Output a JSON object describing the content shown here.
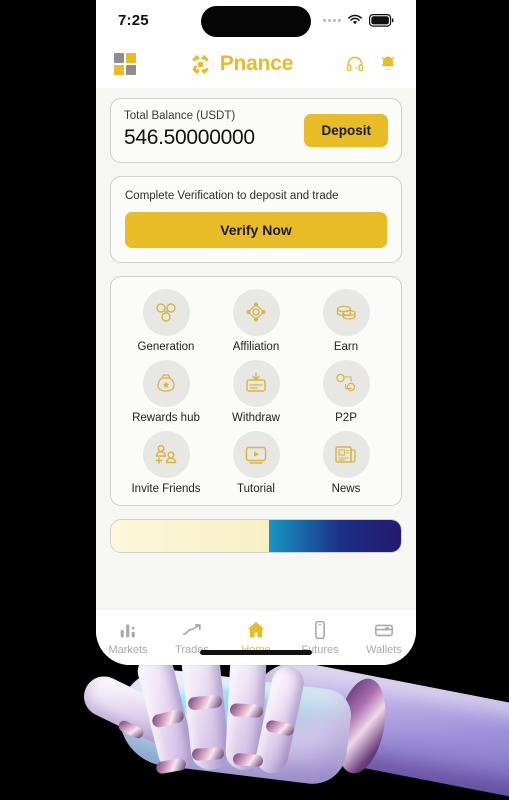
{
  "status_bar": {
    "time": "7:25",
    "signal_icon": "signal-dots-icon",
    "wifi_icon": "wifi-icon",
    "battery_icon": "battery-full-icon"
  },
  "header": {
    "logo_icon": "app-squares-logo-icon",
    "brand_mark_icon": "pnance-diamond-logo-icon",
    "brand_name": "Pnance",
    "support_icon": "headset-support-icon",
    "notification_icon": "bell-notification-icon"
  },
  "balance_card": {
    "label": "Total Balance (USDT)",
    "value": "546.50000000",
    "deposit_label": "Deposit"
  },
  "verification_card": {
    "message": "Complete Verification to deposit and trade",
    "button_label": "Verify Now"
  },
  "shortcuts": [
    {
      "label": "Generation",
      "icon": "generation-network-icon"
    },
    {
      "label": "Affiliation",
      "icon": "affiliation-nodes-icon"
    },
    {
      "label": "Earn",
      "icon": "earn-coins-icon"
    },
    {
      "label": "Rewards hub",
      "icon": "rewards-money-bag-icon"
    },
    {
      "label": "Withdraw",
      "icon": "withdraw-card-arrow-icon"
    },
    {
      "label": "P2P",
      "icon": "p2p-exchange-icon"
    },
    {
      "label": "Invite Friends",
      "icon": "invite-friends-icon"
    },
    {
      "label": "Tutorial",
      "icon": "tutorial-video-icon"
    },
    {
      "label": "News",
      "icon": "news-paper-icon"
    }
  ],
  "promo_banner": {
    "left_color": "#F7EFC6",
    "right_gradient_start": "#1797C4",
    "right_gradient_end": "#241A6E"
  },
  "tabbar": {
    "items": [
      {
        "label": "Markets",
        "icon": "bar-chart-icon",
        "active": false
      },
      {
        "label": "Trades",
        "icon": "trend-line-icon",
        "active": false
      },
      {
        "label": "Home",
        "icon": "home-icon",
        "active": true
      },
      {
        "label": "Futures",
        "icon": "phone-device-icon",
        "active": false
      },
      {
        "label": "Wallets",
        "icon": "wallet-icon",
        "active": false
      }
    ]
  },
  "theme": {
    "accent": "#E8BC26",
    "screen_bg": "#F6F6F3",
    "card_bg": "#FBFBF9",
    "tile_circle": "#E7E7E4",
    "inactive_tab": "#A9A9A9"
  }
}
